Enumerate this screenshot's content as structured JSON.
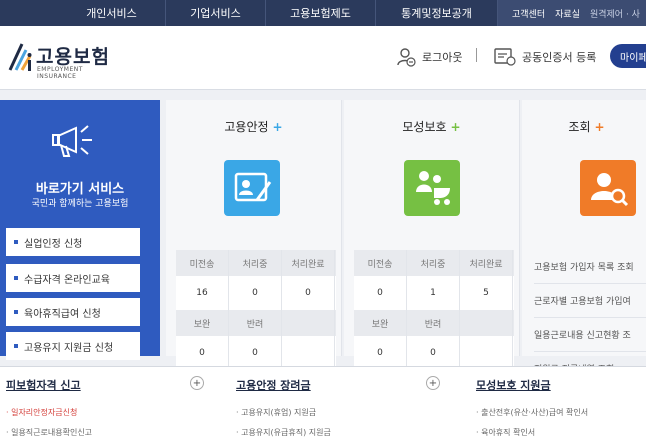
{
  "topnav": {
    "items": [
      "개인서비스",
      "기업서비스",
      "고용보험제도",
      "통계및정보공개"
    ],
    "util": [
      "고객센터",
      "자료실",
      "원격제어 · 사"
    ]
  },
  "header": {
    "logo_name": "고용보험",
    "logo_sub": "EMPLOYMENT INSURANCE",
    "logout_label": "로그아웃",
    "cert_label": "공동인증서 등록",
    "mypage_label": "마이페이"
  },
  "quick": {
    "title": "바로가기 서비스",
    "subtitle": "국민과 함께하는 고용보험",
    "buttons": [
      "실업인정 신청",
      "수급자격 온라인교육",
      "육아휴직급여 신청",
      "고용유지 지원금 신청"
    ]
  },
  "panels": [
    {
      "title": "고용안정",
      "plus_color": "#3aa7e6",
      "headers": [
        "미전송",
        "처리중",
        "처리완료"
      ],
      "values": [
        "16",
        "0",
        "0"
      ],
      "headers2": [
        "보완",
        "반려"
      ],
      "values2": [
        "0",
        "0"
      ]
    },
    {
      "title": "모성보호",
      "plus_color": "#76c043",
      "headers": [
        "미전송",
        "처리중",
        "처리완료"
      ],
      "values": [
        "0",
        "1",
        "5"
      ],
      "headers2": [
        "보완",
        "반려"
      ],
      "values2": [
        "0",
        "0"
      ]
    },
    {
      "title": "조회",
      "plus_color": "#f07b28",
      "items": [
        "고용보험 가입자 목록 조회",
        "근로자별 고용보험 가입여",
        "일용근로내용 신고현황 조",
        "지원금 지급내역 조회"
      ]
    }
  ],
  "bottom": [
    {
      "title": "피보험자격 신고",
      "lines": [
        "· 일자리안정자금신청",
        "· 일용직근로내용확인신고"
      ]
    },
    {
      "title": "고용안정 장려금",
      "lines": [
        "· 고용유지(휴업) 지원금",
        "· 고용유지(유급휴직) 지원금"
      ]
    },
    {
      "title": "모성보호 지원금",
      "lines": [
        "· 출산전후(유산·사산)급여 확인서",
        "· 육아휴직 확인서"
      ]
    }
  ],
  "colors": {
    "nav": "#2b3a5c",
    "quick_bg": "#2f5bbf",
    "mypage": "#233f8f"
  }
}
